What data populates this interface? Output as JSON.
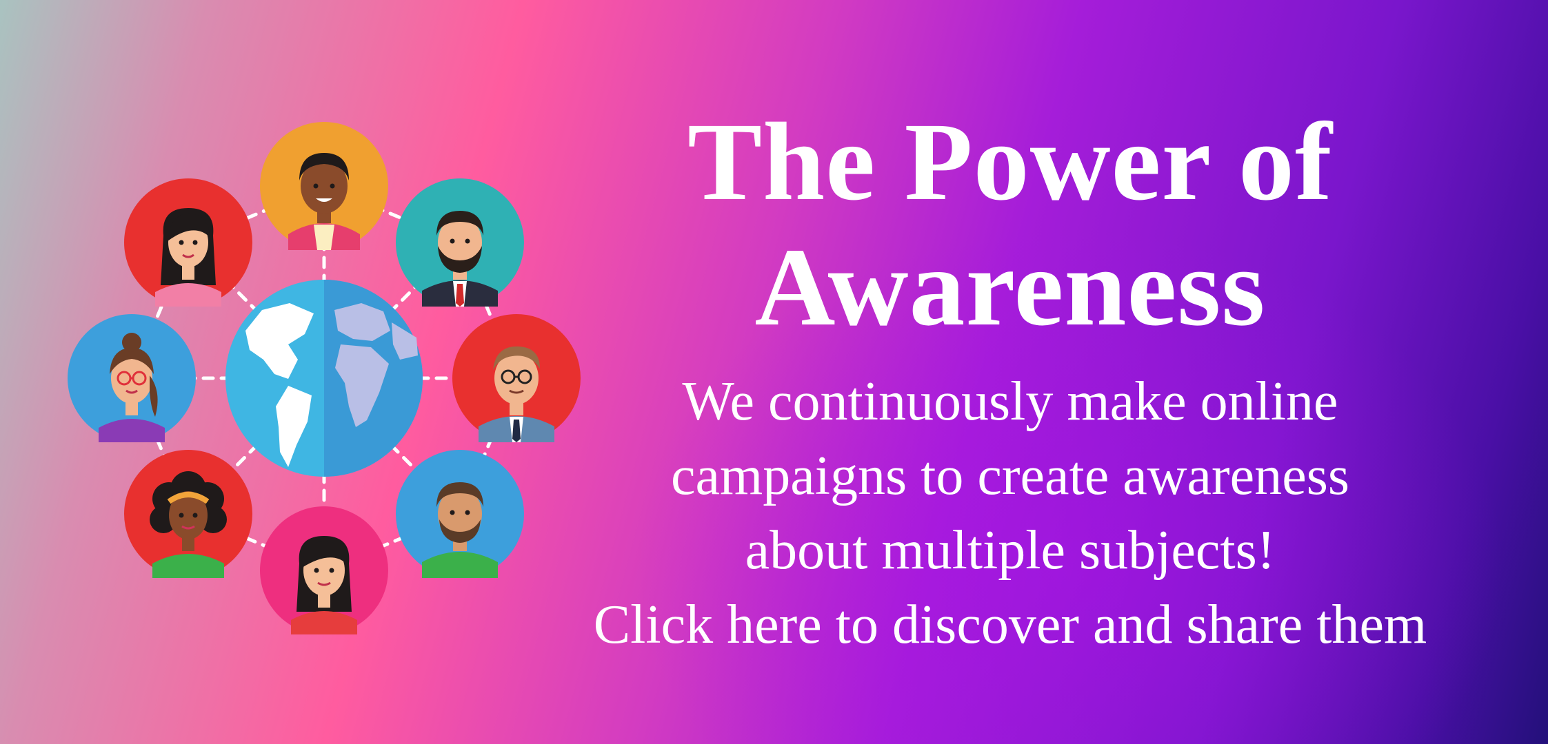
{
  "banner": {
    "headline_line1": "The Power of",
    "headline_line2": "Awareness",
    "body_line1": "We continuously make online",
    "body_line2": "campaigns to create awareness",
    "body_line3": "about multiple subjects!",
    "body_line4": "Click here to discover and share them"
  },
  "colors": {
    "text": "#ffffff",
    "ocean": "#3fb6e3",
    "land": "#ffffff",
    "avatar_orange": "#f0a030",
    "avatar_teal": "#2fb1b4",
    "avatar_red": "#e8302f",
    "avatar_blue": "#3d9fdc",
    "avatar_pink": "#ee2f7f"
  },
  "illustration": {
    "center": "globe-icon",
    "avatars": [
      "avatar-man-orange-bg",
      "avatar-man-beard-teal-bg",
      "avatar-man-glasses-red-bg",
      "avatar-man-beard-blue-bg",
      "avatar-woman-pink-bg",
      "avatar-woman-curly-red-bg",
      "avatar-woman-glasses-blue-bg",
      "avatar-woman-red-bg"
    ]
  }
}
